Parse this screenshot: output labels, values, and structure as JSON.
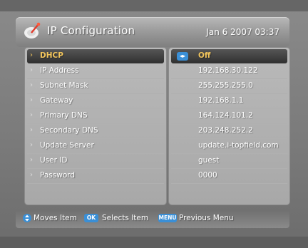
{
  "header": {
    "title": "IP Configuration",
    "datetime": "Jan 6 2007 03:37",
    "logo_icon": "satellite-dish-icon"
  },
  "settings": [
    {
      "label": "DHCP",
      "value": "Off",
      "selected": true
    },
    {
      "label": "IP Address",
      "value": "192.168.30.122"
    },
    {
      "label": "Subnet Mask",
      "value": "255.255.255.0"
    },
    {
      "label": "Gateway",
      "value": "192.168.1.1"
    },
    {
      "label": "Primary DNS",
      "value": "164.124.101.2"
    },
    {
      "label": "Secondary DNS",
      "value": "203.248.252.2"
    },
    {
      "label": "Update Server",
      "value": "update.i-topfield.com"
    },
    {
      "label": "User ID",
      "value": "guest"
    },
    {
      "label": "Password",
      "value": "0000"
    }
  ],
  "footer": {
    "move_text": "Moves Item",
    "ok_key": "OK",
    "select_text": "Selects Item",
    "menu_key": "MENU",
    "menu_text": "Previous Menu"
  },
  "colors": {
    "accent_selected_text": "#f2c55c",
    "key_blue": "#3a8fd6"
  }
}
